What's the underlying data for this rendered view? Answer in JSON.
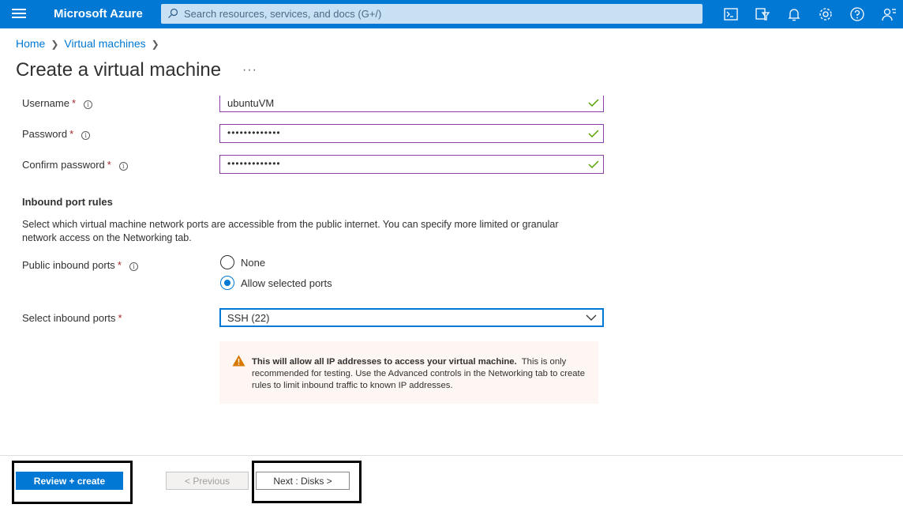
{
  "topbar": {
    "brand": "Microsoft Azure",
    "search_placeholder": "Search resources, services, and docs (G+/)",
    "icons": [
      "cloud-shell-icon",
      "directory-filter-icon",
      "notifications-icon",
      "settings-icon",
      "help-icon",
      "feedback-icon"
    ],
    "accent_color": "#0078d4"
  },
  "breadcrumb": [
    "Home",
    "Virtual machines"
  ],
  "page": {
    "title": "Create a virtual machine",
    "more": "···"
  },
  "form": {
    "username": {
      "label": "Username",
      "value": "ubuntuVM"
    },
    "password": {
      "label": "Password",
      "value": "•••••••••••••"
    },
    "confirm_password": {
      "label": "Confirm password",
      "value": "•••••••••••••"
    },
    "required_marker": "*",
    "info_glyph": "i",
    "inbound_section": {
      "title": "Inbound port rules",
      "description": "Select which virtual machine network ports are accessible from the public internet. You can specify more limited or granular network access on the Networking tab."
    },
    "public_inbound_ports": {
      "label": "Public inbound ports",
      "options": [
        "None",
        "Allow selected ports"
      ],
      "selected": "Allow selected ports"
    },
    "select_inbound_ports": {
      "label": "Select inbound ports",
      "value": "SSH (22)"
    },
    "warning": {
      "bold": "This will allow all IP addresses to access your virtual machine.",
      "text": "This is only recommended for testing.  Use the Advanced controls in the Networking tab to create rules to limit inbound traffic to known IP addresses."
    }
  },
  "footer": {
    "review_create": "Review + create",
    "previous": "< Previous",
    "next": "Next : Disks >"
  }
}
